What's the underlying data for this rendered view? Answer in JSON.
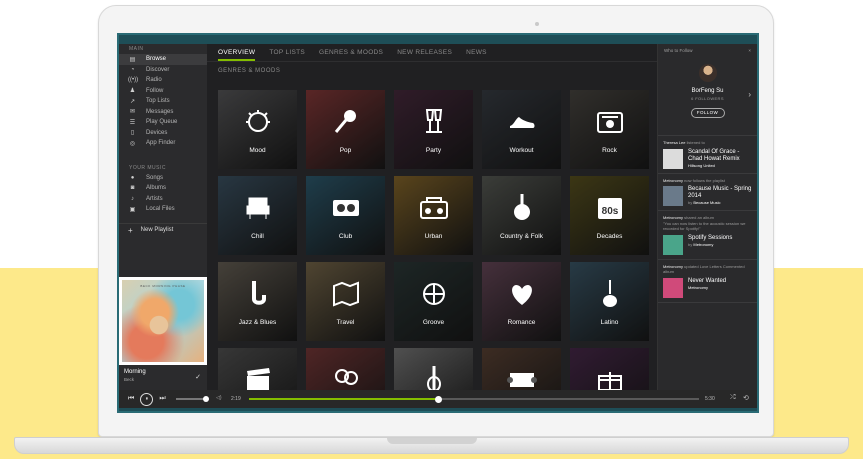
{
  "sidebar": {
    "main_heading": "MAIN",
    "main_items": [
      {
        "icon": "browse-icon",
        "glyph": "▤",
        "label": "Browse",
        "active": true
      },
      {
        "icon": "discover-icon",
        "glyph": "◔",
        "label": "Discover"
      },
      {
        "icon": "radio-icon",
        "glyph": "((•))",
        "label": "Radio"
      },
      {
        "icon": "follow-icon",
        "glyph": "♟",
        "label": "Follow"
      },
      {
        "icon": "top-lists-icon",
        "glyph": "↗",
        "label": "Top Lists"
      },
      {
        "icon": "messages-icon",
        "glyph": "✉",
        "label": "Messages"
      },
      {
        "icon": "play-queue-icon",
        "glyph": "☰",
        "label": "Play Queue"
      },
      {
        "icon": "devices-icon",
        "glyph": "▯",
        "label": "Devices"
      },
      {
        "icon": "app-finder-icon",
        "glyph": "◎",
        "label": "App Finder"
      }
    ],
    "music_heading": "YOUR MUSIC",
    "music_items": [
      {
        "icon": "songs-icon",
        "glyph": "●",
        "label": "Songs"
      },
      {
        "icon": "albums-icon",
        "glyph": "◙",
        "label": "Albums"
      },
      {
        "icon": "artists-icon",
        "glyph": "♪",
        "label": "Artists"
      },
      {
        "icon": "local-files-icon",
        "glyph": "▣",
        "label": "Local Files"
      }
    ],
    "new_playlist": "New Playlist"
  },
  "now_playing": {
    "album_caption": "BECK  MORNING PHASE",
    "track": "Morning",
    "artist": "Beck"
  },
  "main": {
    "tabs": [
      {
        "label": "OVERVIEW",
        "active": true
      },
      {
        "label": "TOP LISTS"
      },
      {
        "label": "GENRES & MOODS"
      },
      {
        "label": "NEW RELEASES"
      },
      {
        "label": "NEWS"
      }
    ],
    "section_title": "GENRES & MOODS",
    "tiles": [
      {
        "label": "Mood",
        "icon": "mood-icon",
        "bg": "#5a5a5c"
      },
      {
        "label": "Pop",
        "icon": "microphone-icon",
        "bg": "#8a3b3b"
      },
      {
        "label": "Party",
        "icon": "champagne-icon",
        "bg": "#4a2b3f"
      },
      {
        "label": "Workout",
        "icon": "sneaker-icon",
        "bg": "#3a3f46"
      },
      {
        "label": "Rock",
        "icon": "amplifier-icon",
        "bg": "#4b4843"
      },
      {
        "label": "Chill",
        "icon": "armchair-icon",
        "bg": "#3e5566"
      },
      {
        "label": "Club",
        "icon": "turntable-icon",
        "bg": "#2f5e73"
      },
      {
        "label": "Urban",
        "icon": "boombox-icon",
        "bg": "#8a6a2c"
      },
      {
        "label": "Country & Folk",
        "icon": "banjo-icon",
        "bg": "#5b5e58"
      },
      {
        "label": "Decades",
        "icon": "calendar-80s-icon",
        "bg": "#5c5420"
      },
      {
        "label": "Jazz & Blues",
        "icon": "saxophone-icon",
        "bg": "#6a6358"
      },
      {
        "label": "Travel",
        "icon": "map-icon",
        "bg": "#7a6a4c"
      },
      {
        "label": "Groove",
        "icon": "disco-ball-icon",
        "bg": "#2d3b3a"
      },
      {
        "label": "Romance",
        "icon": "heart-icon",
        "bg": "#6b4a5c"
      },
      {
        "label": "Latino",
        "icon": "guitar-icon",
        "bg": "#3d5a6b"
      },
      {
        "label": "",
        "icon": "clapperboard-icon",
        "bg": "#555555"
      },
      {
        "label": "",
        "icon": "balloons-icon",
        "bg": "#7a3a3a"
      },
      {
        "label": "",
        "icon": "violin-icon",
        "bg": "#7b7b7b"
      },
      {
        "label": "",
        "icon": "ticket-icon",
        "bg": "#5d4436"
      },
      {
        "label": "",
        "icon": "gift-icon",
        "bg": "#4b2a4d"
      }
    ]
  },
  "right_panel": {
    "title": "Who to Follow",
    "close": "×",
    "profile": {
      "name": "BorFeng Su",
      "followers": "6 FOLLOWERS",
      "follow_label": "FOLLOW"
    },
    "feed": [
      {
        "who": "Theresa Lee",
        "action": "listened to",
        "note": "",
        "title": "Scandal Of Grace - Chad Howat Remix",
        "by_prefix": "",
        "by": "Hillsong United",
        "thumb": "#dcdcdc"
      },
      {
        "who": "Metronomy",
        "action": "now follows the playlist",
        "note": "",
        "title": "Because Music - Spring 2014",
        "by_prefix": "by",
        "by": "Because Music",
        "thumb": "#6a7a8a"
      },
      {
        "who": "Metronomy",
        "action": "shared an album",
        "note": "\"You can now listen to the acoustic session we recorded for Spotify!\"",
        "title": "Spotify Sessions",
        "by_prefix": "by",
        "by": "Metronomy",
        "thumb": "#4aa58a"
      },
      {
        "who": "Metronomy",
        "action": "updated Love Letters Commented album",
        "note": "",
        "title": "Never Wanted",
        "by_prefix": "",
        "by": "Metronomy",
        "thumb": "#d04a7a"
      }
    ]
  },
  "player": {
    "prev_glyph": "⏮",
    "play_glyph": "⏸",
    "next_glyph": "⏭",
    "volume_glyph": "◁)",
    "current_time": "2:19",
    "total_time": "5:30",
    "progress": 0.42,
    "volume": 0.9,
    "shuffle_glyph": "⤮",
    "repeat_glyph": "⟲"
  },
  "colors": {
    "accent": "#84bd00",
    "background": "#202022",
    "stage": "#fde98a"
  }
}
